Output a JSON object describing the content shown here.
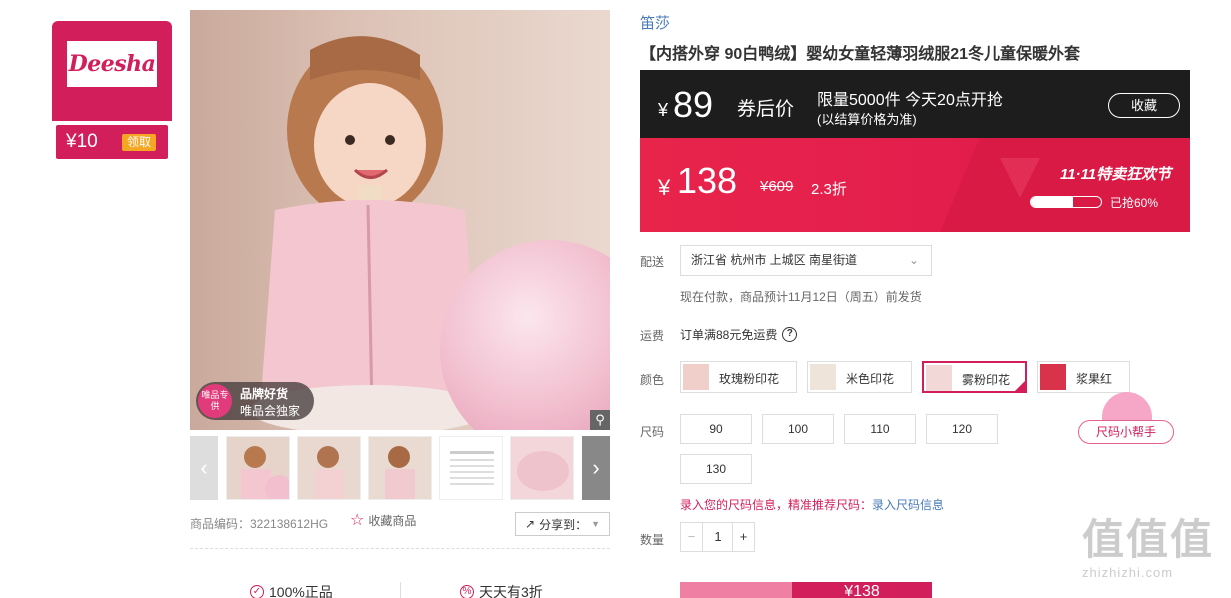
{
  "brand_card": {
    "logo_text": "Deesha",
    "coupon_amount": "¥10",
    "coupon_button": "领取"
  },
  "gallery": {
    "badge_icon_text": "唯品专供",
    "badge_title": "品牌好货",
    "badge_subtitle": "唯品会独家",
    "zoom_icon": "magnifier-icon",
    "prev_icon": "chevron-left-icon",
    "next_icon": "chevron-right-icon",
    "product_code": "商品编码：322138612HG",
    "favorite_label": "收藏商品",
    "share_label": "分享到："
  },
  "guarantees": [
    {
      "label": "100%正品",
      "icon": "shield-check-icon"
    },
    {
      "label": "天天有3折",
      "icon": "percent-icon"
    }
  ],
  "product": {
    "brand": "笛莎",
    "title": "【内搭外穿 90白鸭绒】婴幼女童轻薄羽绒服21冬儿童保暖外套"
  },
  "promo": {
    "currency": "¥",
    "coupon_price": "89",
    "coupon_price_label": "券后价",
    "limit_text": "限量5000件 今天20点开抢",
    "limit_note": "(以结算价格为准)",
    "collect_label": "收藏",
    "sale_price": "138",
    "original_price": "¥609",
    "discount": "2.3折",
    "festival": "11·11特卖狂欢节",
    "sold_fraction": 0.6,
    "sold_text": "已抢60%"
  },
  "delivery": {
    "label": "配送",
    "address": "浙江省 杭州市 上城区 南星街道",
    "ship_note": "现在付款，商品预计11月12日（周五）前发货"
  },
  "freight": {
    "label": "运费",
    "text": "订单满88元免运费",
    "help_icon": "question-circle-icon"
  },
  "colors": {
    "label": "颜色",
    "options": [
      "玫瑰粉印花",
      "米色印花",
      "雾粉印花",
      "浆果红"
    ],
    "selected": "雾粉印花",
    "swatches": [
      "#f0cfcb",
      "#efe4da",
      "#f3d8d8",
      "#d8334a"
    ]
  },
  "sizes": {
    "label": "尺码",
    "options": [
      "90",
      "100",
      "110",
      "120",
      "130"
    ],
    "helper": "尺码小帮手",
    "info_text": "录入您的尺码信息，精准推荐尺码：",
    "info_link": "录入尺码信息"
  },
  "quantity": {
    "label": "数量",
    "value": "1",
    "minus": "−",
    "plus": "+"
  },
  "buy": {
    "right_price": "¥138"
  },
  "watermark": {
    "big": "值值值",
    "small": "zhizhizhi.com"
  }
}
